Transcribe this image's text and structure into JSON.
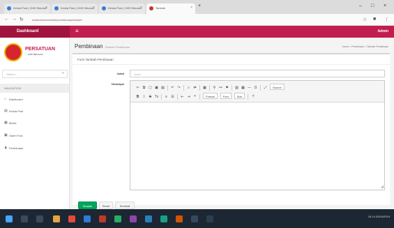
{
  "browser": {
    "tabs": [
      {
        "title": "Kelola Post | CMS Sekolah",
        "active": false
      },
      {
        "title": "Kelola Post | CMS Sekolah",
        "active": false
      },
      {
        "title": "Kelola Post | CMS Sekolah",
        "active": false
      },
      {
        "title": "Tambah",
        "active": true
      }
    ],
    "url": "localhost/cms/admin/pembinaan/tambah"
  },
  "app": {
    "brand": "Dashboard",
    "user": "Admin"
  },
  "sidebar": {
    "logo_title": "PERSATUAN",
    "logo_subtitle": "CMS SEKOLAH",
    "search_placeholder": "Search...",
    "header": "NAVIGATION",
    "items": [
      {
        "label": "Dashboard",
        "icon": "home-icon"
      },
      {
        "label": "Kelola Post",
        "icon": "file-icon"
      },
      {
        "label": "Berita",
        "icon": "newspaper-icon"
      },
      {
        "label": "Galeri Foto",
        "icon": "image-icon"
      },
      {
        "label": "Pembinaan",
        "icon": "users-icon"
      }
    ]
  },
  "page": {
    "title": "Pembinaan",
    "subtitle": "Tambah Pembinaan",
    "breadcrumb": "Home > Pembinaan > Tambah Pembinaan",
    "box_title": "Form Tambah Pembinaan",
    "fields": {
      "judul_label": "Judul",
      "judul_placeholder": "Judul",
      "deskripsi_label": "Deskripsi"
    },
    "editor": {
      "format_label": "Format",
      "font_label": "Font",
      "size_label": "Size",
      "source_label": "Source"
    },
    "buttons": {
      "simpan": "Simpan",
      "reset": "Reset",
      "kembali": "Kembali"
    }
  },
  "taskbar": {
    "time": "10:14",
    "date": "02/04/2019"
  },
  "colors": {
    "header": "#c21d4f",
    "brand": "#a0143d",
    "save": "#00a65a"
  }
}
